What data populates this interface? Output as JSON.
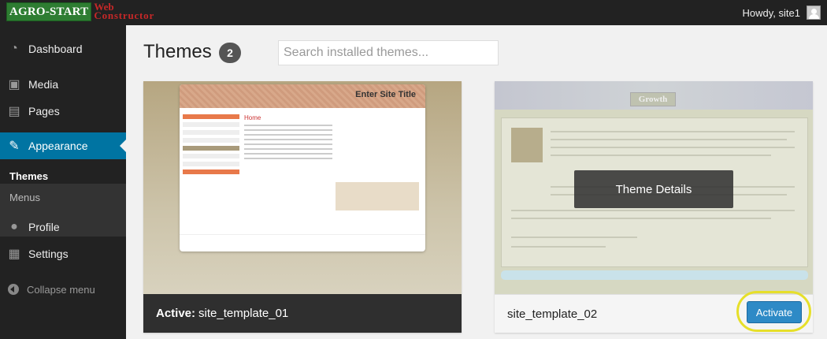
{
  "brand": {
    "agro": "AGRO-START",
    "web": "Web",
    "constructor": "Constructor"
  },
  "topbar": {
    "greeting": "Howdy, site1"
  },
  "sidebar": {
    "items": [
      {
        "label": "Dashboard",
        "icon": "dashboard-icon"
      },
      {
        "label": "Media",
        "icon": "media-icon"
      },
      {
        "label": "Pages",
        "icon": "pages-icon"
      },
      {
        "label": "Appearance",
        "icon": "appearance-icon",
        "active": true
      },
      {
        "label": "Profile",
        "icon": "profile-icon"
      },
      {
        "label": "Settings",
        "icon": "settings-icon"
      }
    ],
    "submenu": [
      "Themes",
      "Menus"
    ],
    "collapse_label": "Collapse menu"
  },
  "header": {
    "title": "Themes",
    "count": "2"
  },
  "search": {
    "placeholder": "Search installed themes..."
  },
  "themes": [
    {
      "active_prefix": "Active:",
      "name": "site_template_01",
      "preview_title": "Enter Site Title",
      "preview_nav": "Home"
    },
    {
      "name": "site_template_02",
      "preview_title": "Growth",
      "details_label": "Theme Details",
      "activate_label": "Activate"
    }
  ],
  "colors": {
    "accent": "#0074a2",
    "activate": "#2e8ac6",
    "highlight": "#e6df2a"
  }
}
